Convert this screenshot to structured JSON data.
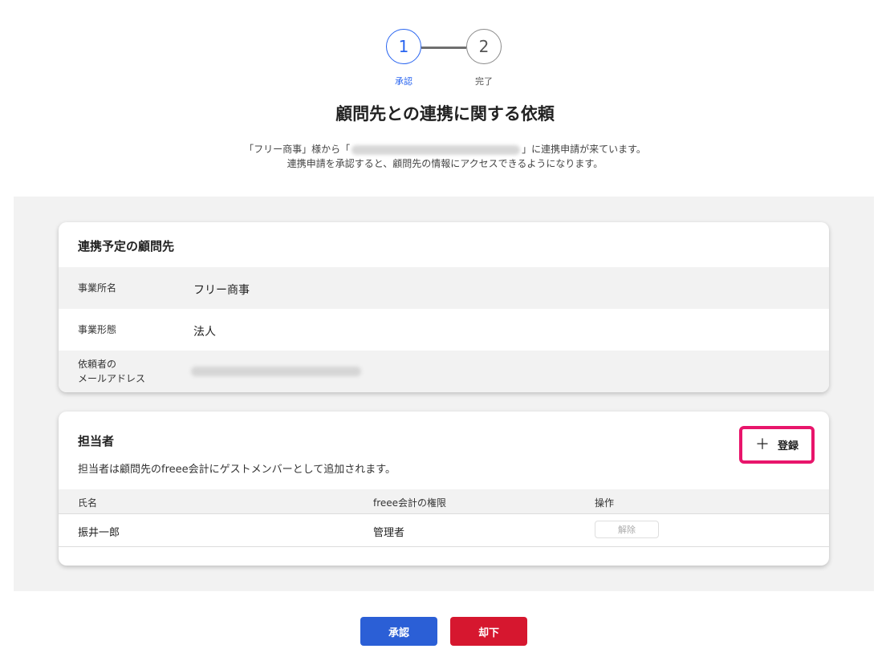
{
  "stepper": {
    "steps": [
      {
        "number": "1",
        "label": "承認"
      },
      {
        "number": "2",
        "label": "完了"
      }
    ],
    "accent_color": "#2864f0"
  },
  "title": "顧問先との連携に関する依頼",
  "intro": {
    "line1_prefix": "「フリー商事」様から「",
    "line1_suffix": "」に連携申請が来ています。",
    "line2": "連携申請を承認すると、顧問先の情報にアクセスできるようになります。"
  },
  "partner_card": {
    "title": "連携予定の顧問先",
    "rows": [
      {
        "label": "事業所名",
        "value": "フリー商事"
      },
      {
        "label": "事業形態",
        "value": "法人"
      },
      {
        "label_line1": "依頼者の",
        "label_line2": "メールアドレス"
      }
    ]
  },
  "staff_card": {
    "title": "担当者",
    "subtitle": "担当者は顧問先のfreee会計にゲストメンバーとして追加されます。",
    "add_button_label": "登録",
    "highlight_color": "#e8156b",
    "table": {
      "headers": [
        "氏名",
        "freee会計の権限",
        "操作"
      ],
      "rows": [
        {
          "name": "振井一郎",
          "role": "管理者",
          "action": "解除"
        }
      ]
    }
  },
  "footer": {
    "approve_label": "承認",
    "reject_label": "却下",
    "approve_color": "#2b5fd6",
    "reject_color": "#d6172f"
  }
}
